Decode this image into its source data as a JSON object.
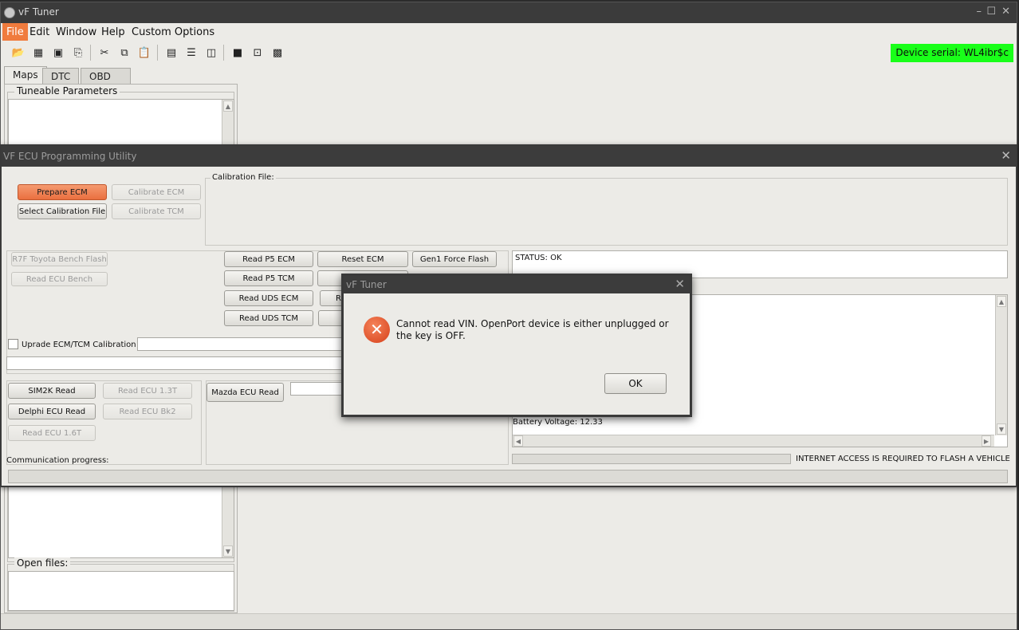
{
  "main": {
    "title": "vF Tuner",
    "menu": [
      "File",
      "Edit",
      "Window",
      "Help",
      "Custom Options"
    ],
    "device_serial": "Device serial: WL4ibr$c",
    "tabs": [
      "Maps",
      "DTC",
      "OBD Logger"
    ],
    "tuneable_title": "Tuneable Parameters",
    "open_files_title": "Open files:"
  },
  "ecu": {
    "title": "VF ECU Programming Utility",
    "prepare_ecm": "Prepare ECM",
    "calibrate_ecm": "Calibrate ECM",
    "select_calibration": "Select Calibration File",
    "calibrate_tcm": "Calibrate TCM",
    "calibration_file_label": "Calibration File:",
    "r7f_bench": "R7F Toyota Bench Flash",
    "read_ecu_bench": "Read ECU Bench",
    "read_p5_ecm": "Read P5 ECM",
    "reset_ecm": "Reset ECM",
    "gen1_force_flash": "Gen1 Force Flash",
    "read_p5_tcm": "Read P5 TCM",
    "read_uds_ecm": "Read UDS ECM",
    "read_uds_tcm": "Read UDS TCM",
    "upgrade_label": "Uprade ECM/TCM Calibration",
    "sim2k_read": "SIM2K Read",
    "read_ecu_13t": "Read ECU 1.3T",
    "delphi_read": "Delphi ECU Read",
    "read_ecu_bk2": "Read ECU Bk2",
    "read_ecu_16t": "Read ECU 1.6T",
    "mazda_read": "Mazda ECU Read",
    "comm_progress": "Communication progress:",
    "status": "STATUS: OK",
    "battery_voltage": "Battery Voltage: 12.33",
    "internet_notice": "INTERNET ACCESS IS REQUIRED TO FLASH A VEHICLE",
    "partial_button_a": "Re",
    "partial_button_b": "R"
  },
  "dialog": {
    "title": "vF Tuner",
    "message": "Cannot read VIN. OpenPort device is either unplugged or the key is OFF.",
    "ok": "OK"
  }
}
